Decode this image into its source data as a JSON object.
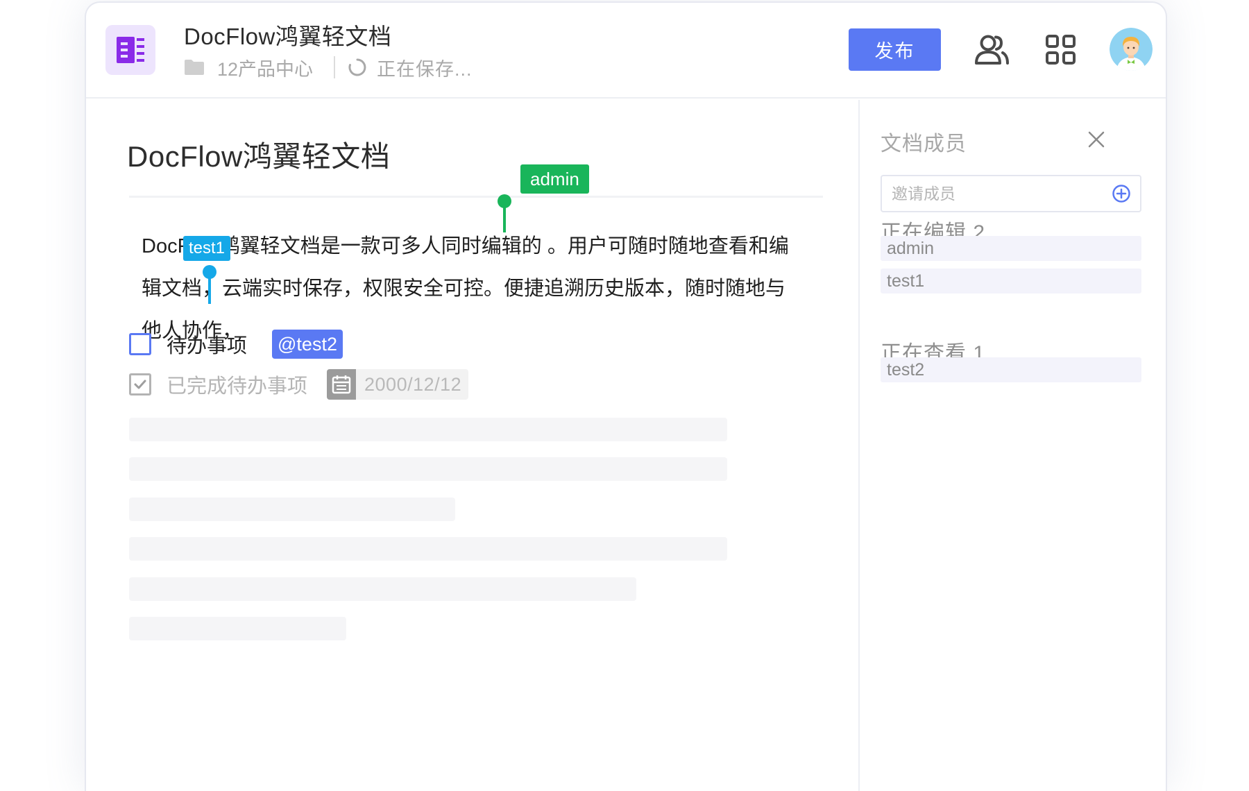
{
  "header": {
    "doc_title": "DocFlow鸿翼轻文档",
    "folder_name": "12产品中心",
    "save_status": "正在保存...",
    "publish_label": "发布"
  },
  "editor": {
    "title": "DocFlow鸿翼轻文档",
    "body_lines": [
      "DocFlow鸿翼轻文档是一款可多人同时编辑的 。用户可随时随地查看和编",
      "辑文档，云端实时保存，权限安全可控。便捷追溯历史版本，随时随地与",
      "他人协作，"
    ],
    "cursors": [
      {
        "user": "admin",
        "color": "#19b55a"
      },
      {
        "user": "test1",
        "color": "#15a8e8"
      }
    ],
    "todos": [
      {
        "label": "待办事项",
        "done": false,
        "mention": "@test2"
      },
      {
        "label": "已完成待办事项",
        "done": true,
        "date": "2000/12/12"
      }
    ]
  },
  "panel": {
    "title": "文档成员",
    "invite_placeholder": "邀请成员",
    "editing_heading": "正在编辑 2",
    "editing_members": [
      "admin",
      "test1"
    ],
    "viewing_heading": "正在查看 1",
    "viewing_members": [
      "test2"
    ]
  },
  "colors": {
    "accent": "#5a79f3",
    "admin_cursor": "#19b55a",
    "test1_cursor": "#15a8e8",
    "logo_bg": "#ede4fd",
    "logo_fg": "#8a2be8"
  },
  "icons": {
    "logo": "docflow-logo-icon",
    "folder": "folder-icon",
    "saving": "spinner-icon",
    "members": "members-icon",
    "apps": "grid-apps-icon",
    "close": "close-icon",
    "add": "plus-circle-icon",
    "calendar": "calendar-icon"
  }
}
